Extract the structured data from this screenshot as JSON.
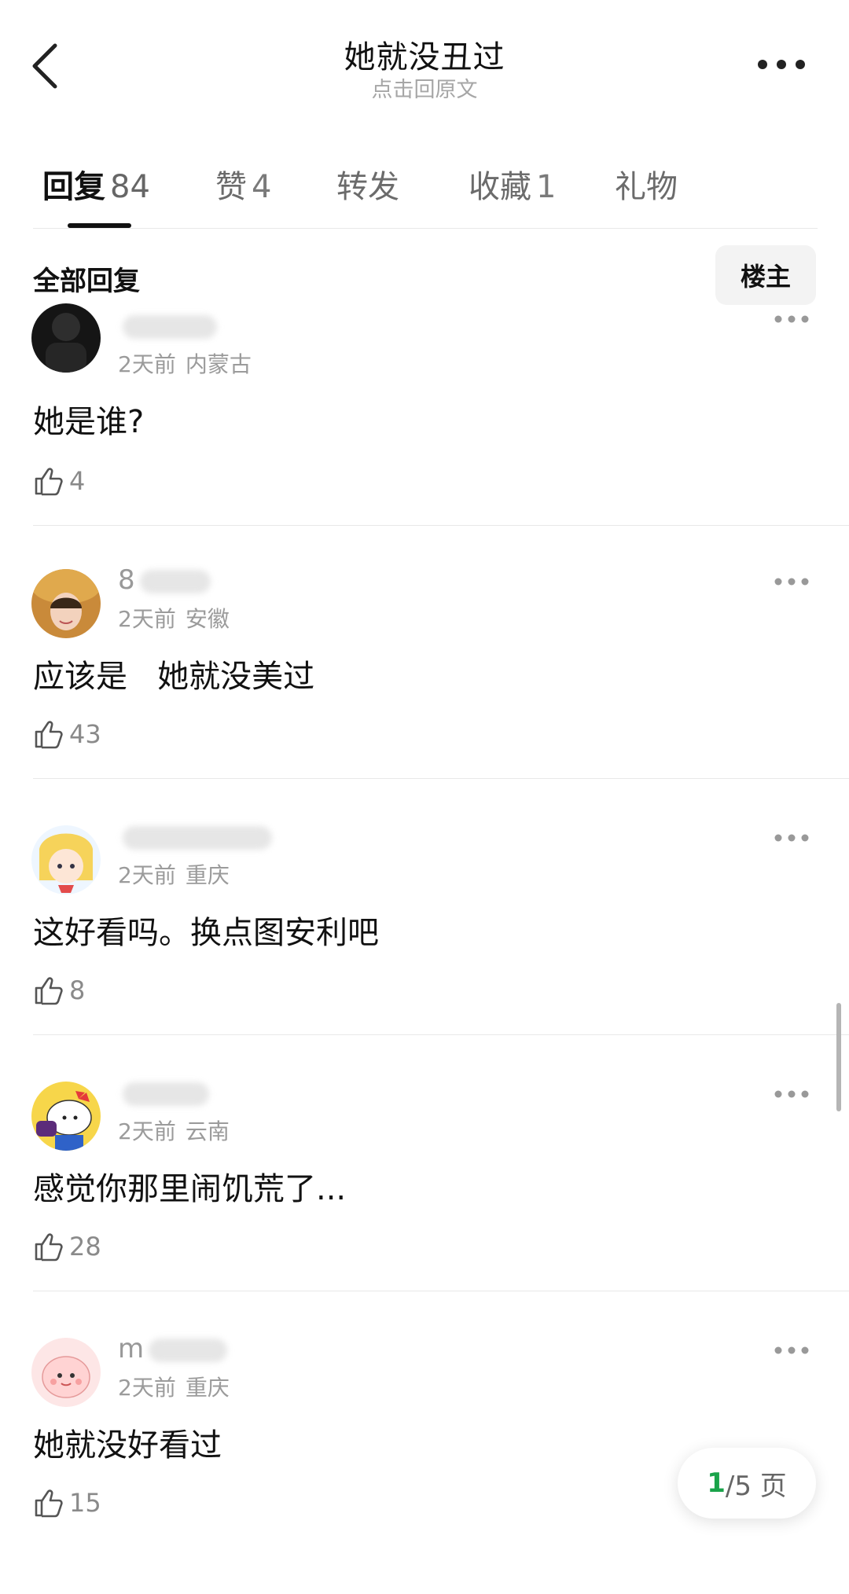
{
  "header": {
    "title": "她就没丑过",
    "subtitle": "点击回原文",
    "back_icon": "back-chevron-icon",
    "more_icon": "more-dots-icon"
  },
  "tabs": [
    {
      "label": "回复",
      "count": "84",
      "active": true
    },
    {
      "label": "赞",
      "count": "4",
      "active": false
    },
    {
      "label": "转发",
      "count": "",
      "active": false
    },
    {
      "label": "收藏",
      "count": "1",
      "active": false
    },
    {
      "label": "礼物",
      "count": "",
      "active": false
    }
  ],
  "section": {
    "title": "全部回复",
    "filter_button": "楼主"
  },
  "comments": [
    {
      "name_visible": "",
      "time": "2天前",
      "location": "内蒙古",
      "text": "她是谁?",
      "likes": "4",
      "avatar": "dark-photo"
    },
    {
      "name_visible": "8",
      "time": "2天前",
      "location": "安徽",
      "text": "应该是   她就没美过",
      "likes": "43",
      "avatar": "woman-straw-hat"
    },
    {
      "name_visible": "",
      "time": "2天前",
      "location": "重庆",
      "text": "这好看吗。换点图安利吧",
      "likes": "8",
      "avatar": "anime-girl"
    },
    {
      "name_visible": "",
      "time": "2天前",
      "location": "云南",
      "text": "感觉你那里闹饥荒了...",
      "likes": "28",
      "avatar": "hello-kitty"
    },
    {
      "name_visible": "m",
      "time": "2天前",
      "location": "重庆",
      "text": "她就没好看过",
      "likes": "15",
      "avatar": "pink-cartoon"
    }
  ],
  "pager": {
    "current": "1",
    "total_text": "/5 页"
  },
  "colors": {
    "accent_green": "#1aa34a",
    "muted_text": "#9b9b9b",
    "divider": "#e8e8e8"
  }
}
